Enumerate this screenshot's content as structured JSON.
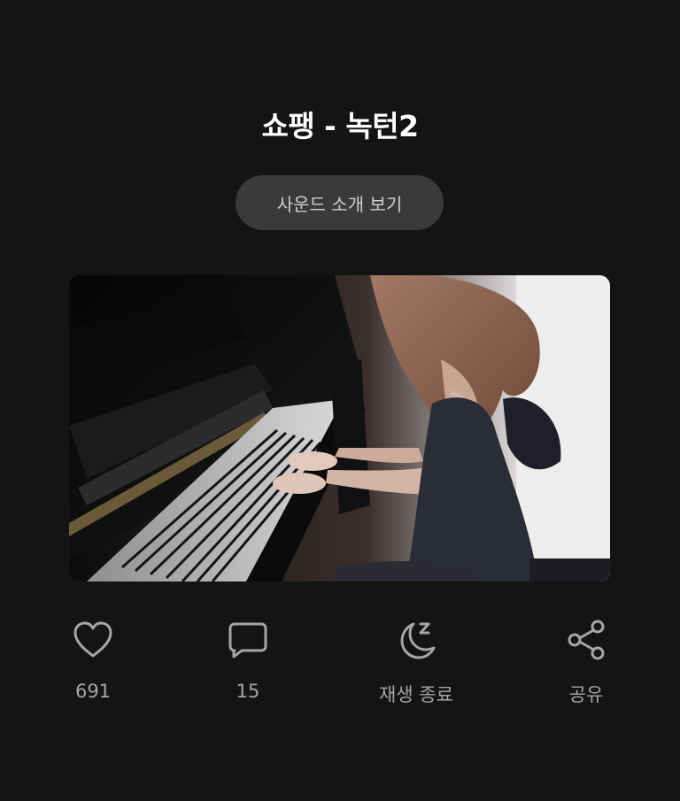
{
  "header": {
    "title": "쇼팽 - 녹턴2",
    "intro_button_label": "사운드 소개 보기"
  },
  "media": {
    "description_icon": "video-thumbnail"
  },
  "actions": [
    {
      "icon": "heart-icon",
      "label": "691"
    },
    {
      "icon": "comment-icon",
      "label": "15"
    },
    {
      "icon": "sleep-timer-icon",
      "label": "재생 종료"
    },
    {
      "icon": "share-icon",
      "label": "공유"
    }
  ],
  "colors": {
    "background": "#141414",
    "button_bg": "#3a3a3a",
    "icon": "#a6a6a6"
  }
}
